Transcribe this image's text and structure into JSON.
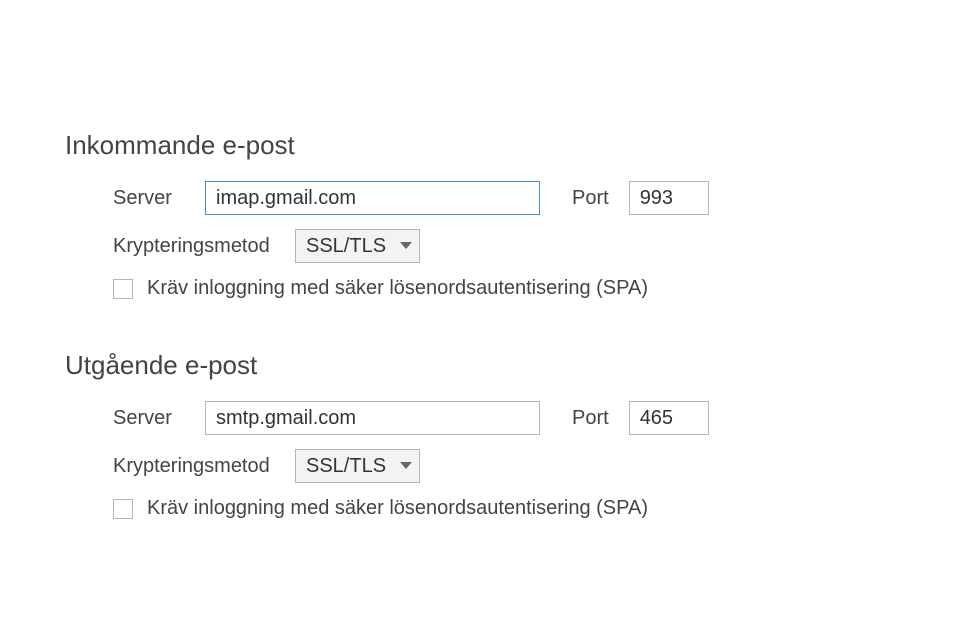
{
  "incoming": {
    "title": "Inkommande e-post",
    "server_label": "Server",
    "server_value": "imap.gmail.com",
    "port_label": "Port",
    "port_value": "993",
    "encryption_label": "Krypteringsmetod",
    "encryption_value": "SSL/TLS",
    "spa_checked": false,
    "spa_label": "Kräv inloggning med säker lösenordsautentisering (SPA)"
  },
  "outgoing": {
    "title": "Utgående e-post",
    "server_label": "Server",
    "server_value": "smtp.gmail.com",
    "port_label": "Port",
    "port_value": "465",
    "encryption_label": "Krypteringsmetod",
    "encryption_value": "SSL/TLS",
    "spa_checked": false,
    "spa_label": "Kräv inloggning med säker lösenordsautentisering (SPA)"
  }
}
